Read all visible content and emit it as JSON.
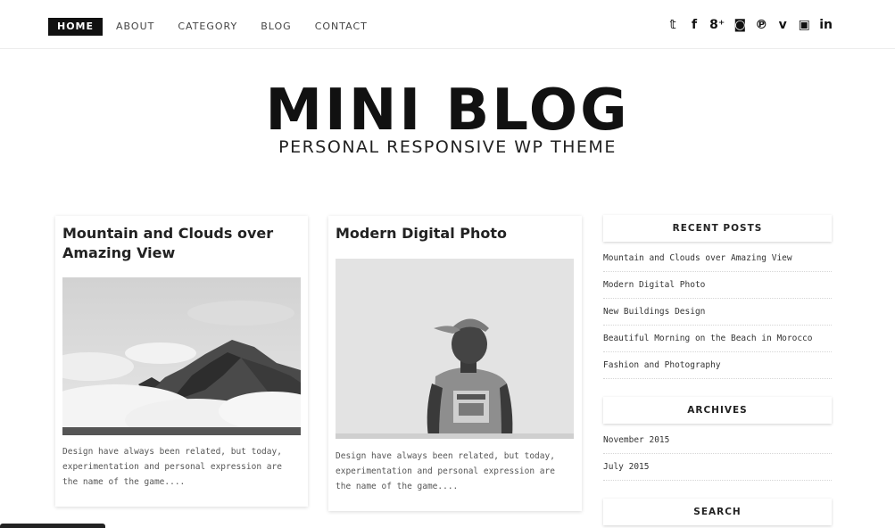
{
  "nav": {
    "items": [
      {
        "label": "HOME",
        "active": true
      },
      {
        "label": "ABOUT"
      },
      {
        "label": "CATEGORY"
      },
      {
        "label": "BLOG"
      },
      {
        "label": "CONTACT"
      }
    ]
  },
  "social": {
    "icons": [
      {
        "name": "twitter-icon",
        "glyph": "𝕥"
      },
      {
        "name": "facebook-icon",
        "glyph": "f"
      },
      {
        "name": "google-plus-icon",
        "glyph": "8⁺"
      },
      {
        "name": "instagram-icon",
        "glyph": "◙"
      },
      {
        "name": "pinterest-icon",
        "glyph": "℗"
      },
      {
        "name": "vimeo-icon",
        "glyph": "v"
      },
      {
        "name": "youtube-icon",
        "glyph": "▣"
      },
      {
        "name": "linkedin-icon",
        "glyph": "in"
      }
    ]
  },
  "header": {
    "title": "MINI BLOG",
    "tagline": "PERSONAL RESPONSIVE WP THEME"
  },
  "posts": [
    {
      "title": "Mountain and Clouds over Amazing View",
      "excerpt": "Design have always been related, but today, experimentation and personal expression are the name of the game....",
      "image": "mountain-clouds-photo"
    },
    {
      "title": "Modern Digital Photo",
      "excerpt": "Design have always been related, but today, experimentation and personal expression are the name of the game....",
      "image": "man-with-cap-photo"
    }
  ],
  "sidebar": {
    "recent_title": "RECENT POSTS",
    "recent_posts": [
      "Mountain and Clouds over Amazing View",
      "Modern Digital Photo",
      "New Buildings Design",
      "Beautiful Morning on the Beach in Morocco",
      "Fashion and Photography"
    ],
    "archives_title": "ARCHIVES",
    "archives": [
      "November 2015",
      "July 2015"
    ],
    "search_title": "SEARCH"
  }
}
